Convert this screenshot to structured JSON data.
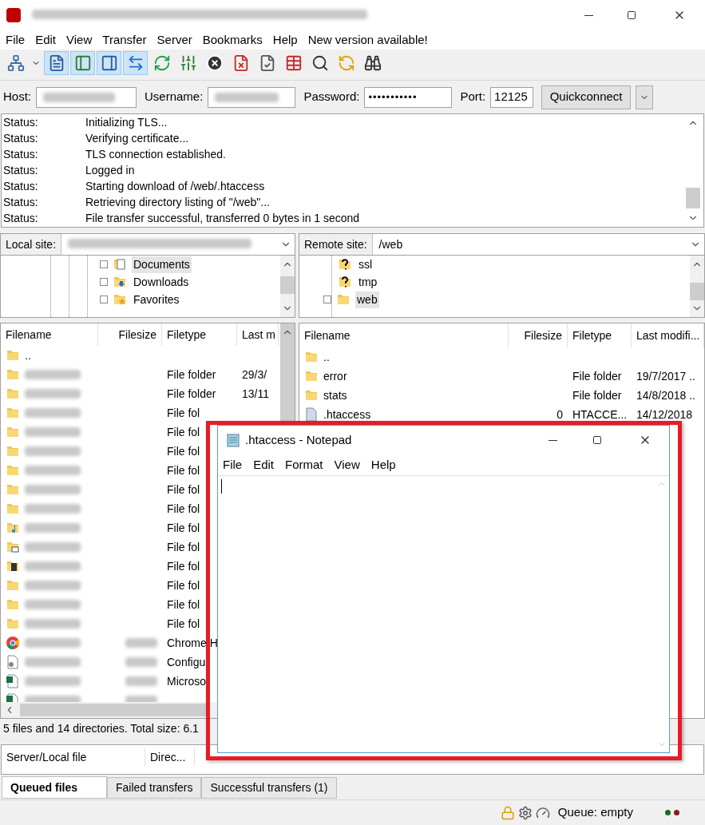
{
  "menu": [
    "File",
    "Edit",
    "View",
    "Transfer",
    "Server",
    "Bookmarks",
    "Help",
    "New version available!"
  ],
  "toolbar": [
    {
      "kind": "site-manager",
      "pressed": false
    },
    {
      "kind": "dropdown",
      "pressed": false
    },
    {
      "kind": "log",
      "pressed": true
    },
    {
      "kind": "local-tree",
      "pressed": true
    },
    {
      "kind": "remote-tree",
      "pressed": true
    },
    {
      "kind": "queue",
      "pressed": true
    },
    {
      "kind": "refresh",
      "pressed": false
    },
    {
      "kind": "filter",
      "pressed": false
    },
    {
      "kind": "cancel",
      "pressed": false
    },
    {
      "kind": "disconnect",
      "pressed": false
    },
    {
      "kind": "reconnect",
      "pressed": false
    },
    {
      "kind": "listing",
      "pressed": false
    },
    {
      "kind": "search",
      "pressed": false
    },
    {
      "kind": "sync",
      "pressed": false
    },
    {
      "kind": "find",
      "pressed": false
    }
  ],
  "quickconnect": {
    "host_label": "Host:",
    "username_label": "Username:",
    "password_label": "Password:",
    "password_value": "•••••••••••",
    "port_label": "Port:",
    "port_value": "12125",
    "button": "Quickconnect"
  },
  "message_log": [
    {
      "label": "Status:",
      "text": "Initializing TLS..."
    },
    {
      "label": "Status:",
      "text": "Verifying certificate..."
    },
    {
      "label": "Status:",
      "text": "TLS connection established."
    },
    {
      "label": "Status:",
      "text": "Logged in"
    },
    {
      "label": "Status:",
      "text": "Starting download of /web/.htaccess"
    },
    {
      "label": "Status:",
      "text": "Retrieving directory listing of \"/web\"..."
    },
    {
      "label": "Status:",
      "text": "File transfer successful, transferred 0 bytes in 1 second"
    }
  ],
  "local_site": {
    "label": "Local site:",
    "tree": [
      {
        "name": "Documents",
        "kind": "documents",
        "selected": true
      },
      {
        "name": "Downloads",
        "kind": "downloads",
        "selected": false
      },
      {
        "name": "Favorites",
        "kind": "favorites",
        "selected": false
      }
    ],
    "columns": [
      "Filename",
      "Filesize",
      "Filetype",
      "Last m"
    ],
    "rows": [
      {
        "kind": "folder",
        "name": ".."
      },
      {
        "kind": "folder",
        "filetype": "File folder",
        "date": "29/3/"
      },
      {
        "kind": "folder",
        "filetype": "File folder",
        "date": "13/11"
      },
      {
        "kind": "folder",
        "filetype": "File fol"
      },
      {
        "kind": "folder",
        "filetype": "File fol"
      },
      {
        "kind": "folder",
        "filetype": "File fol"
      },
      {
        "kind": "folder",
        "filetype": "File fol"
      },
      {
        "kind": "folder",
        "filetype": "File fol"
      },
      {
        "kind": "folder",
        "filetype": "File fol"
      },
      {
        "kind": "music",
        "filetype": "File fol"
      },
      {
        "kind": "pictures",
        "filetype": "File fol"
      },
      {
        "kind": "video",
        "filetype": "File fol"
      },
      {
        "kind": "folder",
        "filetype": "File fol"
      },
      {
        "kind": "folder",
        "filetype": "File fol"
      },
      {
        "kind": "folder",
        "filetype": "File fol"
      },
      {
        "kind": "chrome",
        "filetype": "Chrome H"
      },
      {
        "kind": "config",
        "filetype": "Configu"
      },
      {
        "kind": "excel",
        "filetype": "Microso"
      },
      {
        "kind": "excel"
      }
    ],
    "status": "5 files and 14 directories. Total size: 6.1"
  },
  "remote_site": {
    "label": "Remote site:",
    "path": "/web",
    "tree": [
      {
        "name": "ssl",
        "kind": "unknown",
        "selected": false
      },
      {
        "name": "tmp",
        "kind": "unknown",
        "selected": false
      },
      {
        "name": "web",
        "kind": "folder",
        "selected": true
      }
    ],
    "columns": [
      "Filename",
      "Filesize",
      "Filetype",
      "Last modifi..."
    ],
    "rows": [
      {
        "kind": "folder",
        "name": ".."
      },
      {
        "kind": "folder",
        "name": "error",
        "filetype": "File folder",
        "date": "19/7/2017 .."
      },
      {
        "kind": "folder",
        "name": "stats",
        "filetype": "File folder",
        "date": "14/8/2018 .."
      },
      {
        "kind": "file",
        "name": ".htaccess",
        "filesize": "0",
        "filetype": "HTACCE...",
        "date": "14/12/2018"
      }
    ]
  },
  "queue": {
    "columns": [
      "Server/Local file",
      "Direc..."
    ]
  },
  "tabs": [
    {
      "label": "Queued files",
      "selected": true
    },
    {
      "label": "Failed transfers",
      "selected": false
    },
    {
      "label": "Successful transfers (1)",
      "selected": false
    }
  ],
  "status_bar": {
    "queue": "Queue: empty"
  },
  "notepad": {
    "title": ".htaccess - Notepad",
    "menu": [
      "File",
      "Edit",
      "Format",
      "View",
      "Help"
    ]
  }
}
